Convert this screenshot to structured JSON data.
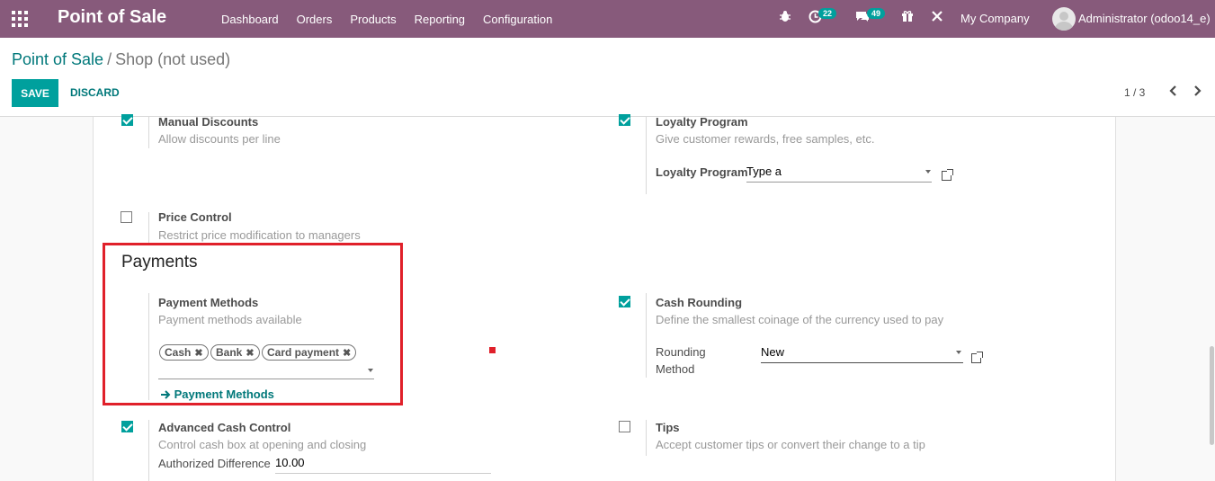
{
  "navbar": {
    "app_title": "Point of Sale",
    "menu": [
      "Dashboard",
      "Orders",
      "Products",
      "Reporting",
      "Configuration"
    ],
    "activity_count": "22",
    "message_count": "49",
    "company": "My Company",
    "user": "Administrator (odoo14_e)"
  },
  "breadcrumb": {
    "parent": "Point of Sale",
    "separator": "/",
    "current": "Shop (not used)"
  },
  "toolbar": {
    "save_label": "SAVE",
    "discard_label": "DISCARD",
    "pager": "1 / 3"
  },
  "settings": {
    "manual_discounts": {
      "title": "Manual Discounts",
      "desc": "Allow discounts per line",
      "checked": true
    },
    "loyalty_program": {
      "title": "Loyalty Program",
      "desc": "Give customer rewards, free samples, etc.",
      "checked": true,
      "field_label": "Loyalty Program",
      "field_value": "Type a"
    },
    "price_control": {
      "title": "Price Control",
      "desc": "Restrict price modification to managers",
      "checked": false
    },
    "payments_heading": "Payments",
    "payment_methods": {
      "title": "Payment Methods",
      "desc": "Payment methods available",
      "tags": [
        "Cash",
        "Bank",
        "Card payment"
      ],
      "link_label": "Payment Methods"
    },
    "cash_rounding": {
      "title": "Cash Rounding",
      "desc": "Define the smallest coinage of the currency used to pay",
      "checked": true,
      "field_label_1": "Rounding",
      "field_label_2": "Method",
      "field_value": "New"
    },
    "advanced_cash_control": {
      "title": "Advanced Cash Control",
      "desc": "Control cash box at opening and closing",
      "checked": true,
      "field_label": "Authorized Difference",
      "field_value": "10.00"
    },
    "tips": {
      "title": "Tips",
      "desc": "Accept customer tips or convert their change to a tip",
      "checked": false
    }
  },
  "colors": {
    "navbar": "#875a7b",
    "accent": "#00a09d",
    "link": "#00787a",
    "highlight": "#e0202a"
  }
}
